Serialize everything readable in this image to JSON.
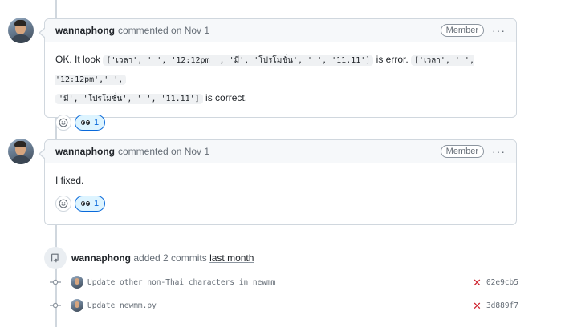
{
  "comments": [
    {
      "author": "wannaphong",
      "meta": "commented on Nov 1",
      "badge": "Member",
      "more": "···",
      "body": {
        "t1": "OK. It look",
        "code1": "['เวลา', ' ', '12:12pm ', 'มี', 'โปรโมชั่น', ' ', '11.11']",
        "t2": "is error.",
        "code2a": "['เวลา', ' ', '12:12pm',' ',",
        "code2b": "'มี', 'โปรโมชั่น', ' ', '11.11']",
        "t3": "is correct."
      },
      "reaction_count": "1"
    },
    {
      "author": "wannaphong",
      "meta": "commented on Nov 1",
      "badge": "Member",
      "more": "···",
      "body": {
        "t1": "I fixed."
      },
      "reaction_count": "1"
    }
  ],
  "event": {
    "author": "wannaphong",
    "action": "added 2 commits",
    "when": "last month"
  },
  "commits": [
    {
      "message": "Update other non-Thai characters in newmm",
      "sha": "02e9cb5",
      "status": "failed"
    },
    {
      "message": "Update newmm.py",
      "sha": "3d889f7",
      "status": "failed"
    }
  ],
  "colors": {
    "fail": "#cf222e",
    "link": "#0969da",
    "border": "#d0d7de"
  },
  "icons": {
    "reaction": "eyes-icon",
    "add_reaction": "smiley-icon",
    "event": "repo-push-icon",
    "commit": "git-commit-icon",
    "status": "x-icon"
  }
}
